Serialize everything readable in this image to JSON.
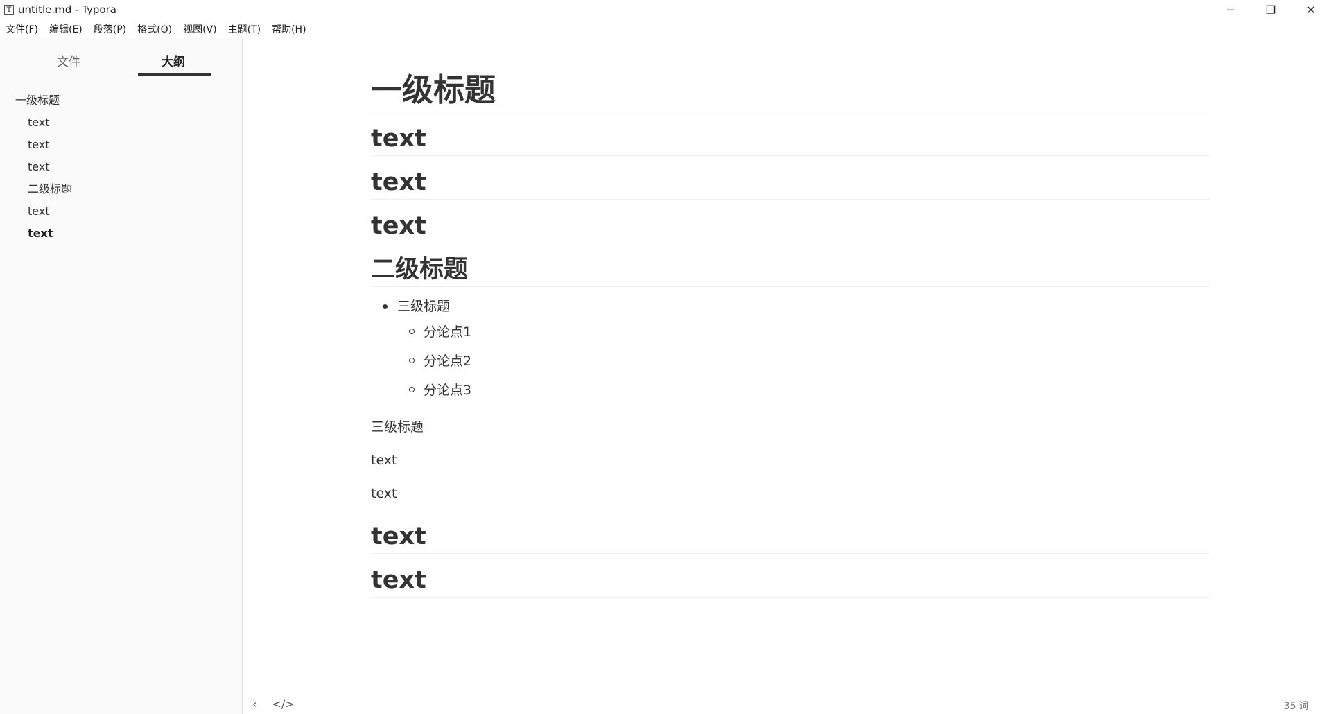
{
  "window": {
    "app_icon": "T",
    "title": "untitle.md - Typora",
    "controls": {
      "minimize": "─",
      "restore": "❐",
      "close": "✕"
    }
  },
  "menubar": {
    "items": [
      "文件(F)",
      "编辑(E)",
      "段落(P)",
      "格式(O)",
      "视图(V)",
      "主题(T)",
      "帮助(H)"
    ]
  },
  "sidebar": {
    "tabs": [
      {
        "label": "文件",
        "active": false
      },
      {
        "label": "大纲",
        "active": true
      }
    ],
    "outline": [
      {
        "label": "一级标题",
        "level": 1,
        "active": false
      },
      {
        "label": "text",
        "level": 2,
        "active": false
      },
      {
        "label": "text",
        "level": 2,
        "active": false
      },
      {
        "label": "text",
        "level": 2,
        "active": false
      },
      {
        "label": "二级标题",
        "level": 2,
        "active": false
      },
      {
        "label": "text",
        "level": 2,
        "active": false
      },
      {
        "label": "text",
        "level": 2,
        "active": true
      }
    ]
  },
  "document": {
    "h1": "一级标题",
    "h2_a": [
      "text",
      "text",
      "text"
    ],
    "h2_b": "二级标题",
    "bullet_l1": "三级标题",
    "bullets_l2": [
      "分论点1",
      "分论点2",
      "分论点3"
    ],
    "paragraphs": [
      "三级标题",
      "text",
      "text"
    ],
    "h2_c": [
      "text",
      "text"
    ]
  },
  "footer": {
    "back_icon": "chevron-left-icon",
    "source_icon": "code-icon",
    "back_glyph": "‹",
    "source_glyph": "</>",
    "word_count": "35 词"
  }
}
